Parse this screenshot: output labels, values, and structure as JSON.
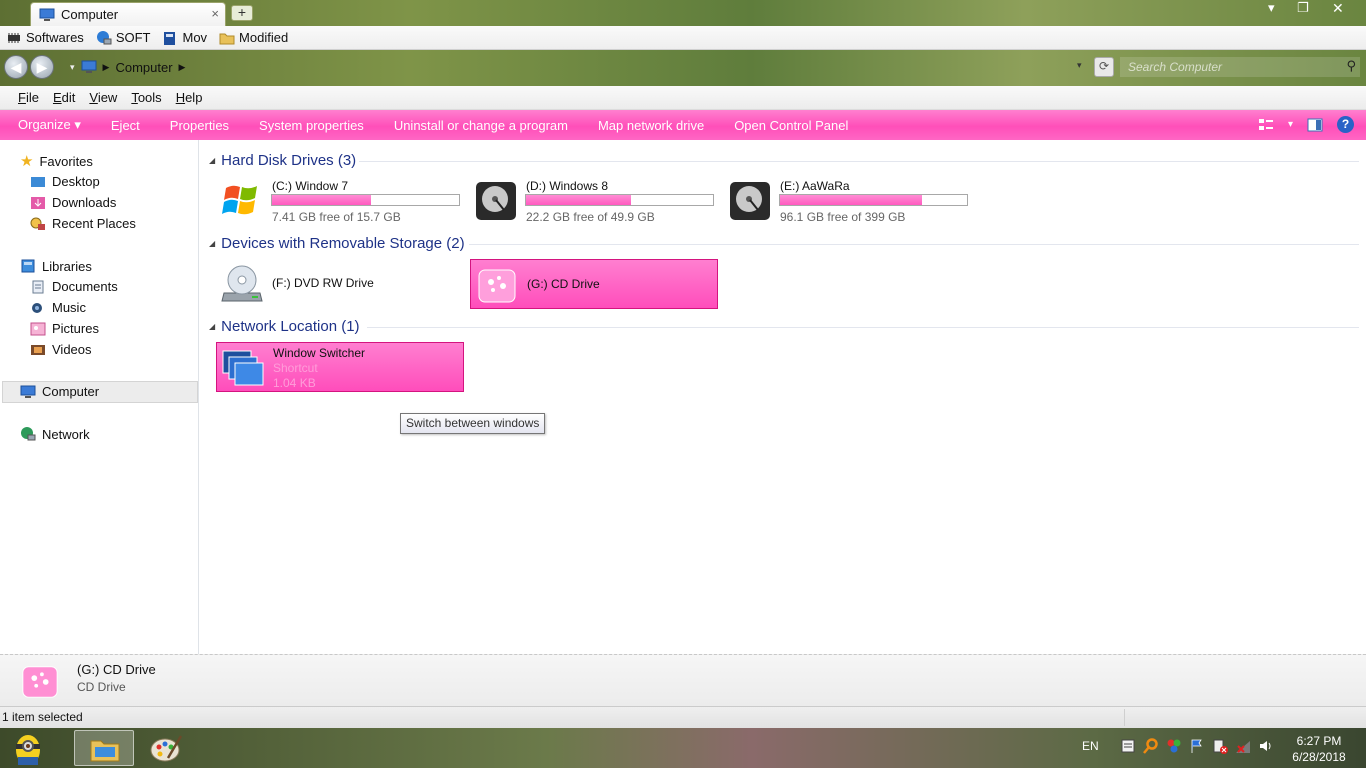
{
  "window": {
    "tab_title": "Computer",
    "tab_close": "×",
    "new_tab": "+"
  },
  "favorites_bar": [
    {
      "label": "Softwares",
      "icon": "chip-icon"
    },
    {
      "label": "SOFT",
      "icon": "network-globe-icon"
    },
    {
      "label": "Mov",
      "icon": "book-icon"
    },
    {
      "label": "Modified",
      "icon": "folder-icon"
    }
  ],
  "address": {
    "location": "Computer",
    "search_placeholder": "Search Computer"
  },
  "menu": [
    "File",
    "Edit",
    "View",
    "Tools",
    "Help"
  ],
  "commands": [
    "Organize ▾",
    "Eject",
    "Properties",
    "System properties",
    "Uninstall or change a program",
    "Map network drive",
    "Open Control Panel"
  ],
  "nav": {
    "favorites": "Favorites",
    "desktop": "Desktop",
    "downloads": "Downloads",
    "recent": "Recent Places",
    "libraries": "Libraries",
    "documents": "Documents",
    "music": "Music",
    "pictures": "Pictures",
    "videos": "Videos",
    "computer": "Computer",
    "network": "Network"
  },
  "groups": {
    "hdd": "Hard Disk Drives (3)",
    "removable": "Devices with Removable Storage (2)",
    "network": "Network Location (1)"
  },
  "drives": [
    {
      "name": "(C:) Window 7",
      "free": "7.41 GB free of 15.7 GB",
      "used_fraction": 0.53
    },
    {
      "name": "(D:) Windows 8",
      "free": "22.2 GB free of 49.9 GB",
      "used_fraction": 0.56
    },
    {
      "name": "(E:) AaWaRa",
      "free": "96.1 GB free of 399 GB",
      "used_fraction": 0.76
    }
  ],
  "removable": [
    {
      "name": "(F:) DVD RW Drive"
    },
    {
      "name": "(G:) CD Drive"
    }
  ],
  "network_location": {
    "name": "Window Switcher",
    "type": "Shortcut",
    "size": "1.04 KB"
  },
  "tooltip": "Switch between windows",
  "details": {
    "name": "(G:) CD Drive",
    "type": "CD Drive"
  },
  "status": "1 item selected",
  "taskbar": {
    "language": "EN",
    "time": "6:27 PM",
    "date": "6/28/2018"
  },
  "colors": {
    "accent_pink": "#ff4fb9",
    "group_header_blue": "#1e3287"
  }
}
